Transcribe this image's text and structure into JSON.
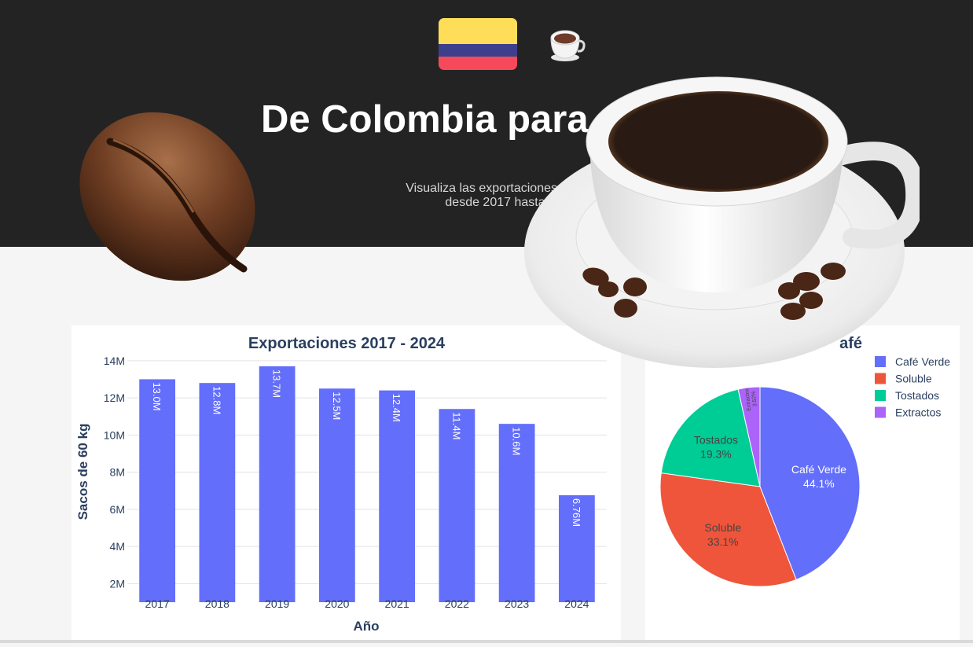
{
  "hero": {
    "title": "De Colombia para",
    "subtitle_line1": "Visualiza las exportaciones de c",
    "subtitle_line2": "desde 2017 hasta"
  },
  "chart_data": [
    {
      "type": "bar",
      "title": "Exportaciones 2017 - 2024",
      "xlabel": "Año",
      "ylabel": "Sacos de 60 kg",
      "categories": [
        "2017",
        "2018",
        "2019",
        "2020",
        "2021",
        "2022",
        "2023",
        "2024"
      ],
      "values": [
        13.0,
        12.8,
        13.7,
        12.5,
        12.4,
        11.4,
        10.6,
        6.76
      ],
      "value_labels": [
        "13.0M",
        "12.8M",
        "13.7M",
        "12.5M",
        "12.4M",
        "11.4M",
        "10.6M",
        "6.76M"
      ],
      "y_ticks": [
        2,
        4,
        6,
        8,
        10,
        12,
        14
      ],
      "y_tick_labels": [
        "2M",
        "4M",
        "6M",
        "8M",
        "10M",
        "12M",
        "14M"
      ],
      "ylim": [
        1,
        14.5
      ],
      "color": "#636efa",
      "grid": true
    },
    {
      "type": "pie",
      "title_visible_fragment": "afé",
      "labels": [
        "Café Verde",
        "Soluble",
        "Tostados",
        "Extractos"
      ],
      "values": [
        44.1,
        33.1,
        19.3,
        3.52
      ],
      "value_labels": [
        "44.1%",
        "33.1%",
        "19.3%",
        "3.52%"
      ],
      "colors": [
        "#636efa",
        "#ef553b",
        "#00cc96",
        "#ab63fa"
      ],
      "legend_position": "top-right"
    }
  ]
}
